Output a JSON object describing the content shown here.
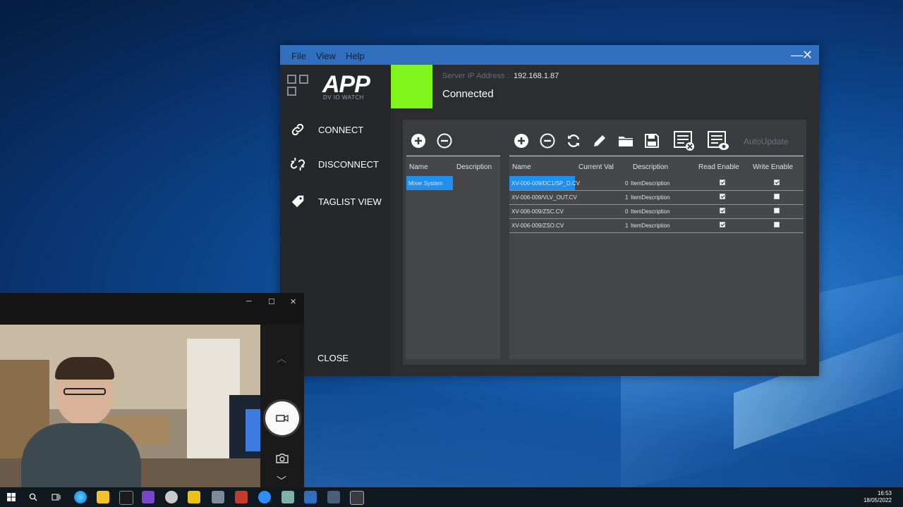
{
  "menu": {
    "file": "File",
    "view": "View",
    "help": "Help"
  },
  "window_controls": {
    "minimize": "—",
    "close": "✕"
  },
  "logo": {
    "title": "APP",
    "subtitle": "DV IO WATCH"
  },
  "sidebar": {
    "items": [
      {
        "label": "CONNECT",
        "icon": "link-icon"
      },
      {
        "label": "DISCONNECT",
        "icon": "broken-link-icon"
      },
      {
        "label": "TAGLIST VIEW",
        "icon": "tag-icon"
      }
    ],
    "close_label": "CLOSE"
  },
  "status": {
    "server_label": "Server IP Address :",
    "server_ip": "192.168.1.87",
    "connection_text": "Connected",
    "color": "#7ff51b"
  },
  "left_table": {
    "columns": [
      "Name",
      "Description"
    ],
    "rows": [
      {
        "name": "Mixer System",
        "description": ""
      }
    ]
  },
  "right_table": {
    "columns": [
      "Name",
      "Current Val",
      "Description",
      "Read Enable",
      "Write Enable"
    ],
    "rows": [
      {
        "name": "XV-006-009/DC1/SP_D.CV",
        "value": "0",
        "description": "ItemDescription",
        "read": true,
        "write": true
      },
      {
        "name": "XV-006-009/VLV_OUT.CV",
        "value": "1",
        "description": "ItemDescription",
        "read": true,
        "write": false
      },
      {
        "name": "XV-006-009/ZSC.CV",
        "value": "0",
        "description": "ItemDescription",
        "read": true,
        "write": false
      },
      {
        "name": "XV-006-009/ZSO.CV",
        "value": "1",
        "description": "ItemDescription",
        "read": true,
        "write": false
      }
    ]
  },
  "toolbar": {
    "autoupdate_label": "AutoUpdate"
  },
  "clock": {
    "time": "16:53",
    "date": "18/05/2022"
  },
  "colors": {
    "titlebar": "#2f6fbd",
    "selection": "#1f8ff0",
    "window_bg": "#2b2d30"
  }
}
